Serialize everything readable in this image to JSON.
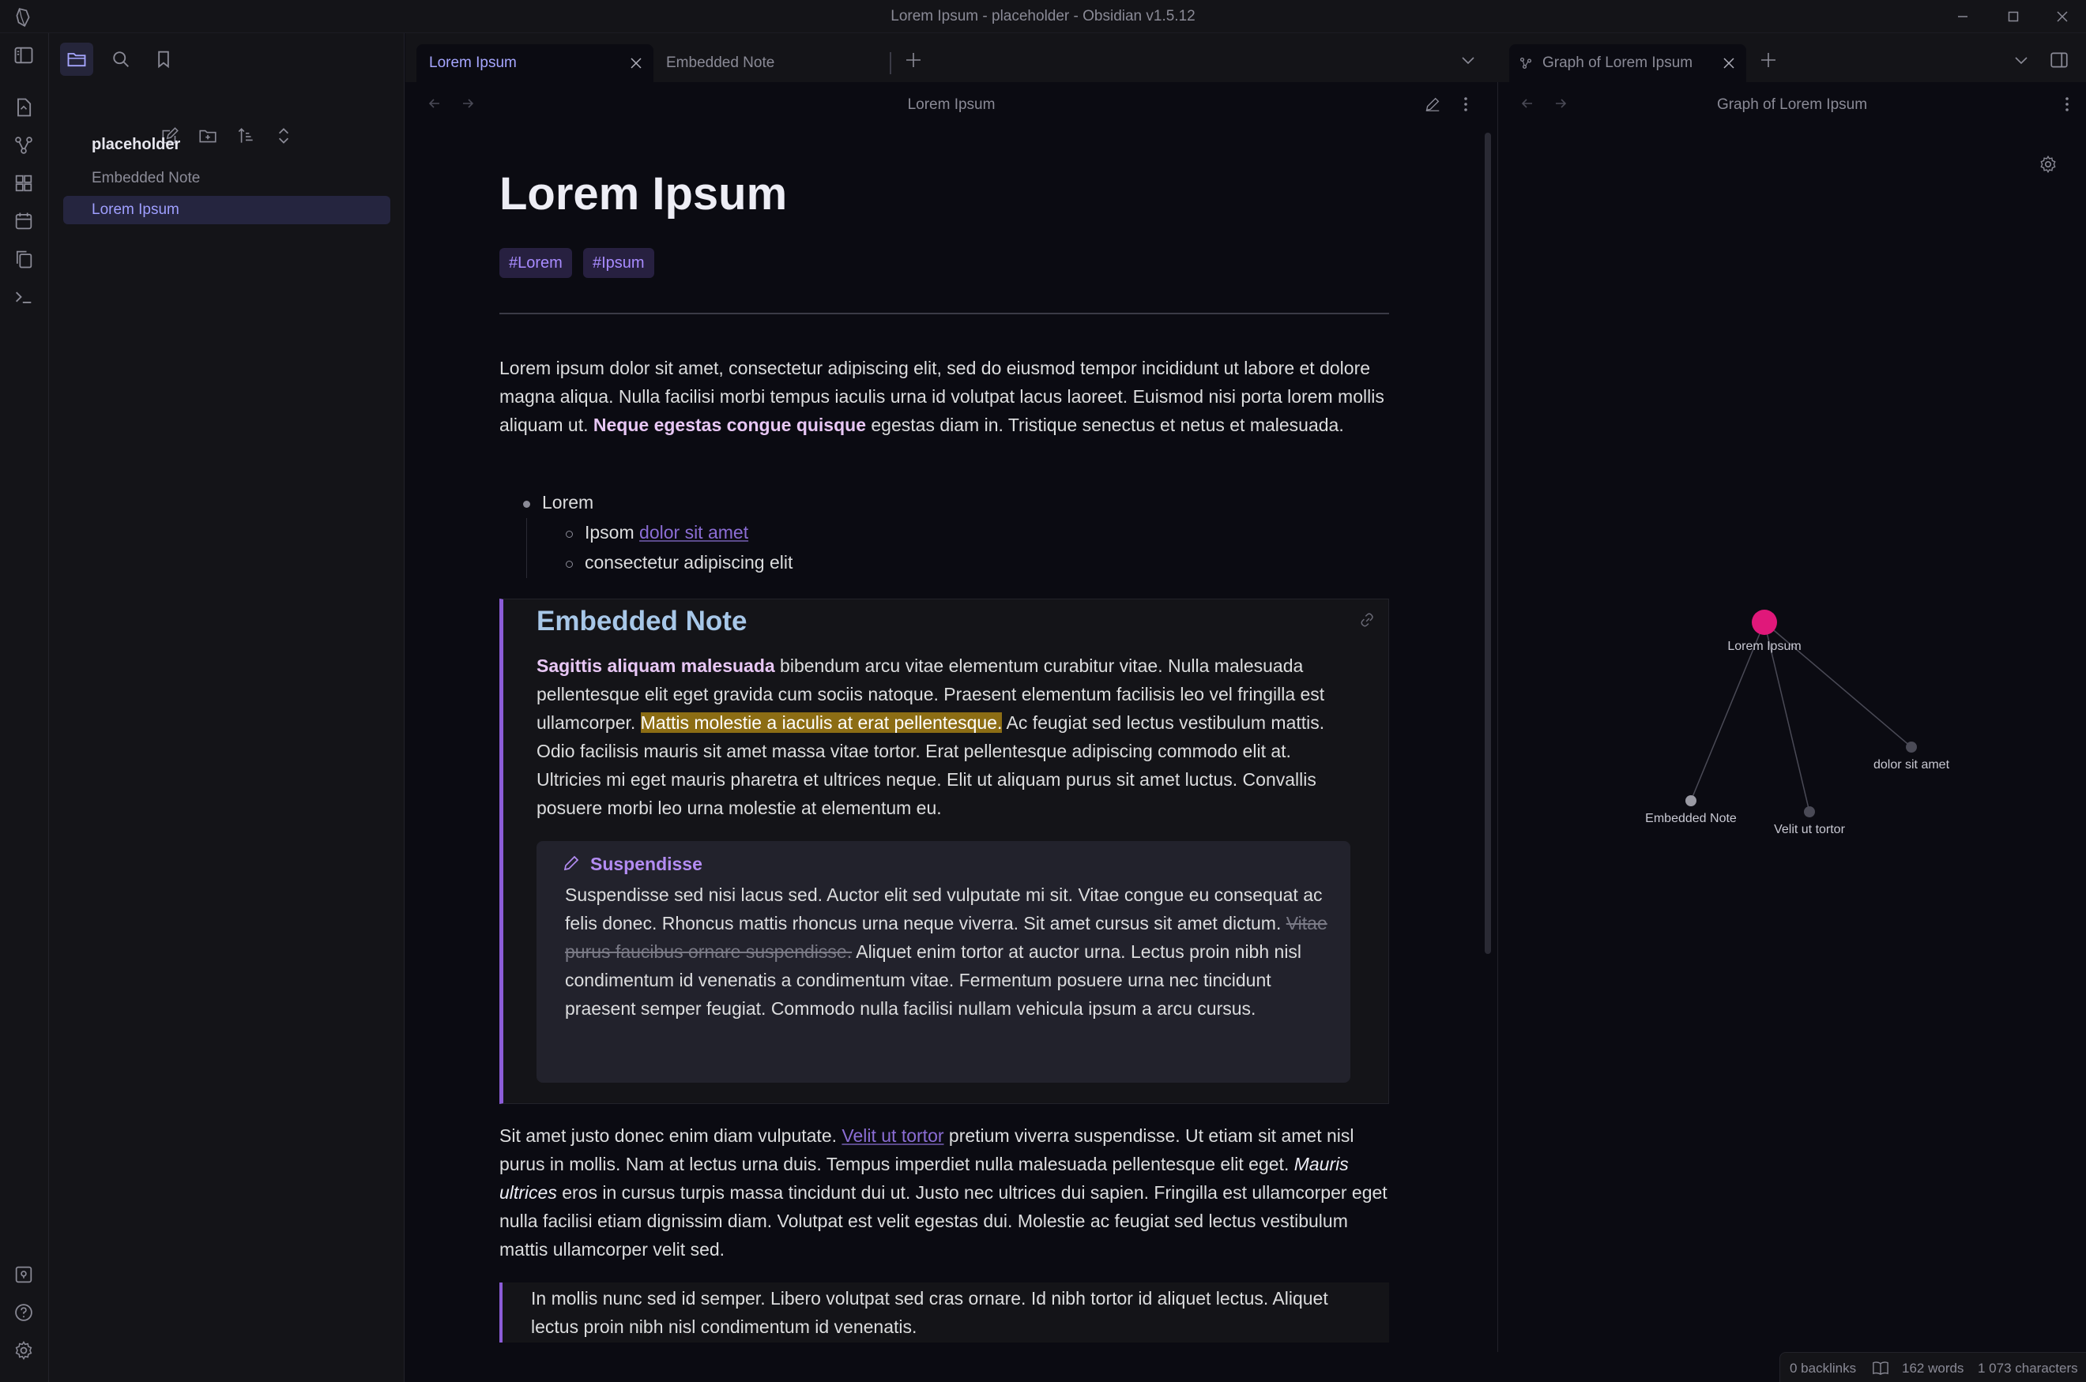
{
  "window": {
    "title": "Lorem Ipsum - placeholder - Obsidian v1.5.12"
  },
  "sidebar": {
    "vault_name": "placeholder",
    "files": [
      {
        "label": "Embedded Note",
        "active": false
      },
      {
        "label": "Lorem Ipsum",
        "active": true
      }
    ]
  },
  "tabs": {
    "main": [
      {
        "label": "Lorem Ipsum",
        "active": true
      },
      {
        "label": "Embedded Note",
        "active": false
      }
    ],
    "right": [
      {
        "label": "Graph of Lorem Ipsum",
        "active": true
      }
    ]
  },
  "main_pane": {
    "header_title": "Lorem Ipsum",
    "note": {
      "title": "Lorem Ipsum",
      "tags": [
        "#Lorem",
        "#Ipsum"
      ],
      "intro_before_bold": "Lorem ipsum dolor sit amet, consectetur adipiscing elit, sed do eiusmod tempor incididunt ut labore et dolore magna aliqua. Nulla facilisi morbi tempus iaculis urna id volutpat lacus laoreet. Euismod nisi porta lorem mollis aliquam ut. ",
      "intro_bold": "Neque egestas congue quisque",
      "intro_after_bold": " egestas diam in. Tristique senectus et netus et malesuada.",
      "list": {
        "item1": "Lorem",
        "sub1_text": "Ipsom ",
        "sub1_link": "dolor sit amet",
        "sub2_text": "consectetur adipiscing elit"
      },
      "embed": {
        "title": "Embedded Note",
        "bold_lead": "Sagittis aliquam malesuada",
        "text_a": " bibendum arcu vitae elementum curabitur vitae. Nulla malesuada pellentesque elit eget gravida cum sociis natoque. Praesent elementum facilisis leo vel fringilla est ullamcorper. ",
        "highlight": "Mattis molestie a iaculis at erat pellentesque.",
        "text_b": " Ac feugiat sed lectus vestibulum mattis. Odio facilisis mauris sit amet massa vitae tortor. Erat pellentesque adipiscing commodo elit at. Ultricies mi eget mauris pharetra et ultrices neque. Elit ut aliquam purus sit amet luctus. Convallis posuere morbi leo urna molestie at elementum eu.",
        "callout": {
          "title": "Suspendisse",
          "text_a": "Suspendisse sed nisi lacus sed. Auctor elit sed vulputate mi sit. Vitae congue eu consequat ac felis donec. Rhoncus mattis rhoncus urna neque viverra. Sit amet cursus sit amet dictum. ",
          "strike": "Vitae purus faucibus ornare suspendisse.",
          "text_b": " Aliquet enim tortor at auctor urna. Lectus proin nibh nisl condimentum id venenatis a condimentum vitae. Fermentum posuere urna nec tincidunt praesent semper feugiat. Commodo nulla facilisi nullam vehicula ipsum a arcu cursus."
        }
      },
      "para2_a": "Sit amet justo donec enim diam vulputate. ",
      "para2_link": "Velit ut tortor",
      "para2_b": " pretium viverra suspendisse. Ut etiam sit amet nisl purus in mollis. Nam at lectus urna duis. Tempus imperdiet nulla malesuada pellentesque elit eget. ",
      "para2_italic": "Mauris ultrices",
      "para2_c": " eros in cursus turpis massa tincidunt dui ut. Justo nec ultrices dui sapien. Fringilla est ullamcorper eget nulla facilisi etiam dignissim diam. Volutpat est velit egestas dui. Molestie ac feugiat sed lectus vestibulum mattis ullamcorper velit sed.",
      "blockquote": "In mollis nunc sed id semper. Libero volutpat sed cras ornare. Id nibh tortor id aliquet lectus. Aliquet lectus proin nibh nisl condimentum id venenatis."
    }
  },
  "graph_pane": {
    "header_title": "Graph of Lorem Ipsum",
    "nodes": [
      {
        "label": "Lorem Ipsum",
        "role": "current"
      },
      {
        "label": "dolor sit amet",
        "role": "unresolved"
      },
      {
        "label": "Embedded Note",
        "role": "resolved"
      },
      {
        "label": "Velit ut tortor",
        "role": "unresolved"
      }
    ],
    "colors": {
      "current_node": "#e0187a",
      "resolved_node": "#9a9aa4",
      "unresolved_node": "#4a4a56",
      "edge": "#4a4a56"
    }
  },
  "status_bar": {
    "backlinks": "0 backlinks",
    "words": "162 words",
    "characters": "1 073 characters"
  },
  "colors": {
    "accent": "#8c5cd8",
    "tag_text": "#a88bff",
    "highlight": "#8c6d14",
    "embed_title": "#a7c7e8",
    "bold_text": "#e8c7f5"
  }
}
